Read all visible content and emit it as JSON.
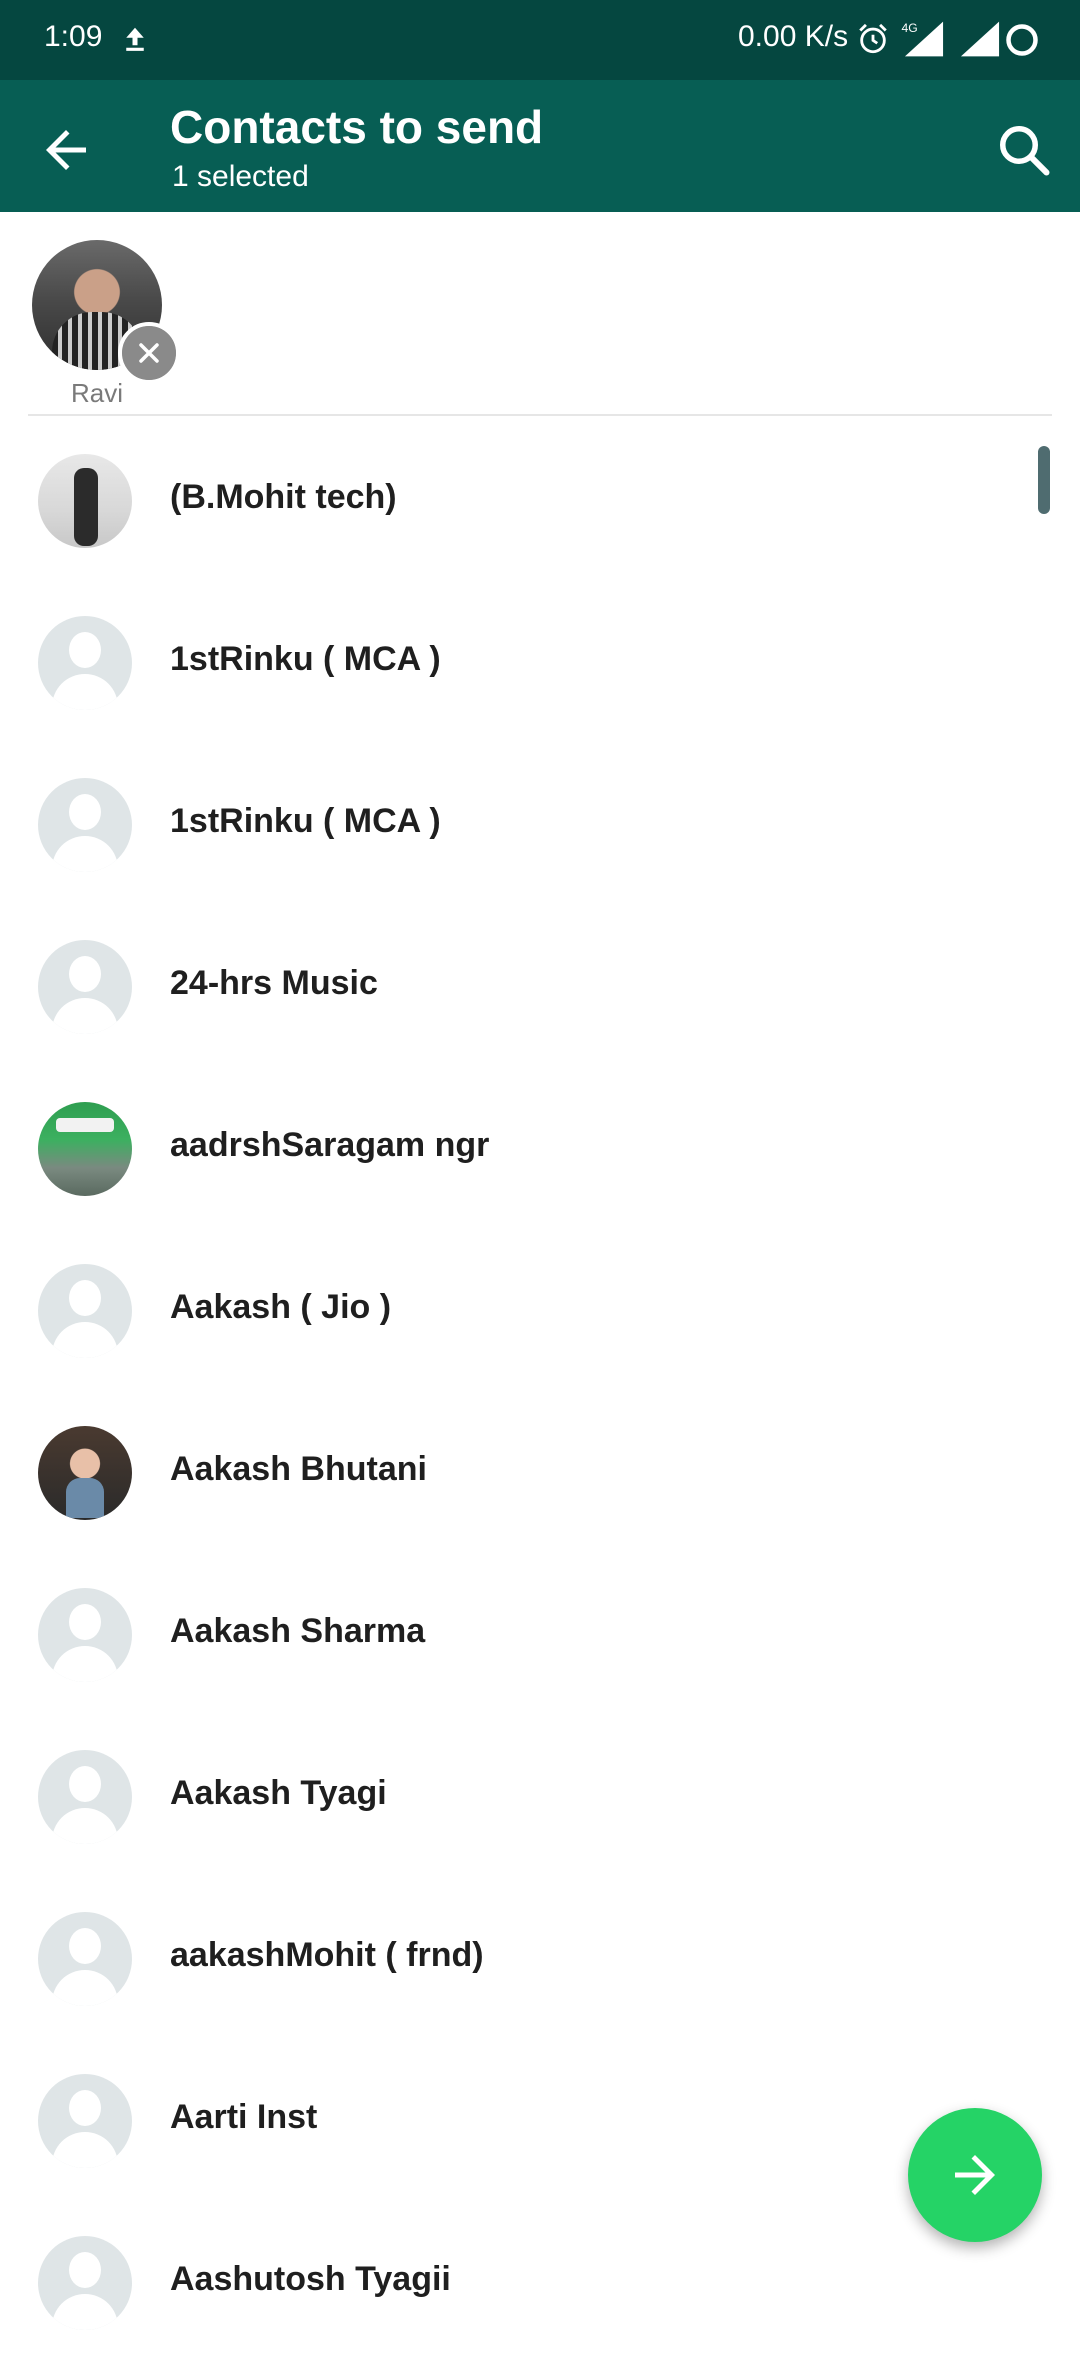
{
  "status_bar": {
    "time": "1:09",
    "net_speed": "0.00 K/s",
    "icons": [
      "upload-icon",
      "alarm-icon",
      "signal-4g-icon",
      "signal-icon",
      "battery-icon"
    ]
  },
  "header": {
    "title": "Contacts to send",
    "subtitle": "1 selected",
    "back_icon": "arrow-back-icon",
    "search_icon": "search-icon",
    "color": "#075e54",
    "status_color": "#054740"
  },
  "selected": [
    {
      "name": "Ravi",
      "remove_icon": "close-icon"
    }
  ],
  "contacts": [
    {
      "name": "(B.Mohit tech)",
      "avatar": "photo"
    },
    {
      "name": "1stRinku ( MCA )",
      "avatar": "default"
    },
    {
      "name": "1stRinku ( MCA )",
      "avatar": "default"
    },
    {
      "name": "24-hrs Music",
      "avatar": "default"
    },
    {
      "name": "aadrshSaragam ngr",
      "avatar": "photo"
    },
    {
      "name": "Aakash ( Jio )",
      "avatar": "default"
    },
    {
      "name": "Aakash Bhutani",
      "avatar": "photo"
    },
    {
      "name": "Aakash Sharma",
      "avatar": "default"
    },
    {
      "name": "Aakash Tyagi",
      "avatar": "default"
    },
    {
      "name": "aakashMohit ( frnd)",
      "avatar": "default"
    },
    {
      "name": "Aarti Inst",
      "avatar": "default"
    },
    {
      "name": "Aashutosh Tyagii",
      "avatar": "default"
    }
  ],
  "fab": {
    "icon": "arrow-forward-icon",
    "color": "#25d366"
  }
}
